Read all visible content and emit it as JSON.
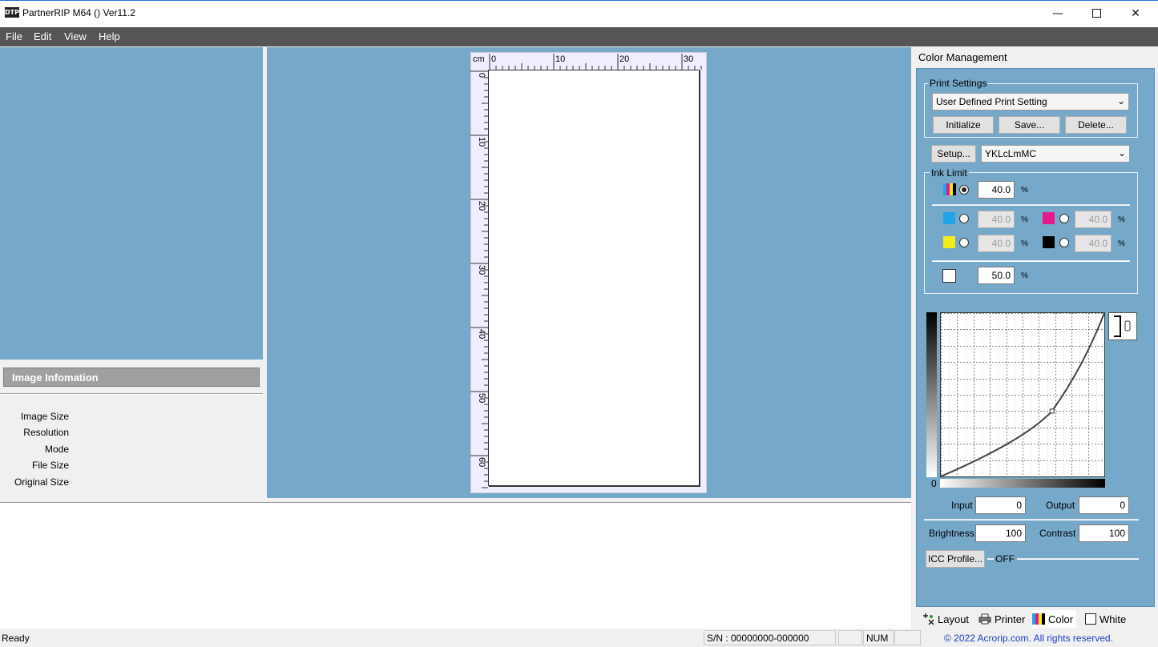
{
  "window": {
    "logo": "DTP",
    "title": "PartnerRIP M64 () Ver11.2",
    "min_icon": "minimize-icon",
    "max_icon": "maximize-icon",
    "close_icon": "close-icon"
  },
  "menu": [
    {
      "label": "File"
    },
    {
      "label": "Edit"
    },
    {
      "label": "View"
    },
    {
      "label": "Help"
    }
  ],
  "image_info": {
    "header": "Image Infomation",
    "labels": [
      "Image Size",
      "Resolution",
      "Mode",
      "File Size",
      "Original Size"
    ]
  },
  "ruler": {
    "unit": "cm",
    "h_ticks": [
      "0",
      "10",
      "20",
      "30"
    ],
    "v_ticks": [
      "0",
      "10",
      "20",
      "30",
      "40",
      "50",
      "60"
    ]
  },
  "color_management": {
    "title": "Color Management",
    "print_settings": {
      "label": "Print Settings",
      "selected": "User Defined Print Setting",
      "initialize": "Initialize",
      "save": "Save...",
      "delete": "Delete..."
    },
    "setup_label": "Setup...",
    "ink_mode": "YKLcLmMC",
    "ink_limit": {
      "label": "Ink Limit",
      "all": "40.0",
      "cyan": "40.0",
      "magenta": "40.0",
      "yellow": "40.0",
      "black": "40.0",
      "white": "50.0",
      "unit": "%"
    },
    "curve": {
      "zero": "0",
      "point_input": 68,
      "point_output": 40
    },
    "input_label": "Input",
    "input_value": "0",
    "output_label": "Output",
    "output_value": "0",
    "brightness_label": "Brightness",
    "brightness_value": "100",
    "contrast_label": "Contrast",
    "contrast_value": "100",
    "icc_label": "ICC Profile...",
    "icc_state": "OFF"
  },
  "tabs": [
    {
      "label": "Layout",
      "icon": "layout-icon"
    },
    {
      "label": "Printer",
      "icon": "printer-icon"
    },
    {
      "label": "Color",
      "icon": "color-icon"
    },
    {
      "label": "White",
      "icon": "white-icon"
    }
  ],
  "status": {
    "ready": "Ready",
    "serial": "S/N : 00000000-000000",
    "num": "NUM",
    "copyright": "© 2022 Acrorip.com. All rights reserved."
  },
  "colors": {
    "accent_blue": "#76a8c9",
    "link": "#1a3fbf",
    "cyan": "#1ea7e8",
    "magenta": "#e6198a",
    "yellow": "#f5ea1a",
    "black": "#000000"
  }
}
